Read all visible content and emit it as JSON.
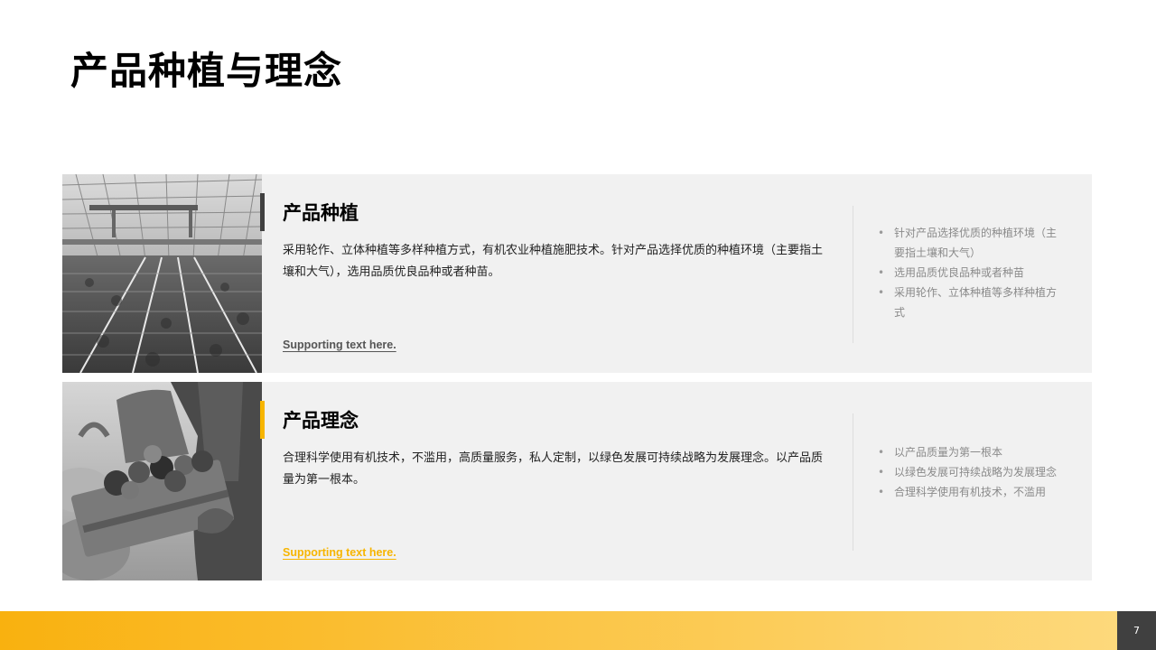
{
  "slide": {
    "title": "产品种植与理念",
    "page_number": "7"
  },
  "colors": {
    "accent_yellow": "#f7b500",
    "accent_dark": "#404040",
    "card_background": "#f1f1f1",
    "footer_gradient_start": "#f9b10f",
    "footer_gradient_end": "#fdd97c"
  },
  "cards": [
    {
      "heading": "产品种植",
      "description": "采用轮作、立体种植等多样种植方式，有机农业种植施肥技术。针对产品选择优质的种植环境（主要指土壤和大气），选用品质优良品种或者种苗。",
      "supporting_text": "Supporting text here.",
      "accent": "dark",
      "image_icon": "greenhouse-photo",
      "bullets": [
        "针对产品选择优质的种植环境（主要指土壤和大气）",
        "选用品质优良品种或者种苗",
        "采用轮作、立体种植等多样种植方式"
      ]
    },
    {
      "heading": "产品理念",
      "description": "合理科学使用有机技术，不滥用，高质量服务，私人定制，以绿色发展可持续战略为发展理念。以产品质量为第一根本。",
      "supporting_text": "Supporting text here.",
      "accent": "yellow",
      "image_icon": "vegetable-crate-photo",
      "bullets": [
        "以产品质量为第一根本",
        "以绿色发展可持续战略为发展理念",
        "合理科学使用有机技术，不滥用"
      ]
    }
  ]
}
